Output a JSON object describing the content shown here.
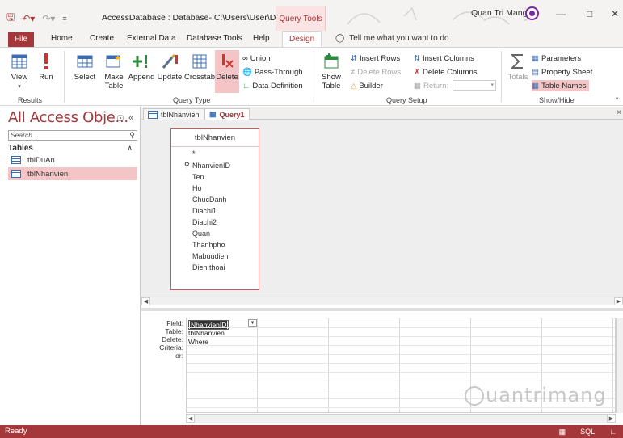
{
  "title_bar": {
    "doc_title": "AccessDatabase : Database- C:\\Users\\User\\Docu...",
    "context_tab": "Query Tools",
    "user": "Quan Tri Mang",
    "save_icon": "save-icon",
    "undo_icon": "undo-icon",
    "redo_icon": "redo-icon"
  },
  "ribbon_tabs": {
    "file": "File",
    "home": "Home",
    "create": "Create",
    "external": "External Data",
    "dbtools": "Database Tools",
    "help": "Help",
    "design": "Design",
    "tell_me": "Tell me what you want to do"
  },
  "ribbon": {
    "results": {
      "view": "View",
      "run": "Run",
      "label": "Results"
    },
    "query_type": {
      "select": "Select",
      "make_table": "Make\nTable",
      "make_table_1": "Make",
      "make_table_2": "Table",
      "append": "Append",
      "update": "Update",
      "crosstab": "Crosstab",
      "delete": "Delete",
      "union": "Union",
      "pass_through": "Pass-Through",
      "data_definition": "Data Definition",
      "label": "Query Type"
    },
    "query_setup": {
      "show_table_1": "Show",
      "show_table_2": "Table",
      "insert_rows": "Insert Rows",
      "delete_rows": "Delete Rows",
      "builder": "Builder",
      "insert_columns": "Insert Columns",
      "delete_columns": "Delete Columns",
      "return": "Return:",
      "label": "Query Setup"
    },
    "show_hide": {
      "totals": "Totals",
      "parameters": "Parameters",
      "property_sheet": "Property Sheet",
      "table_names": "Table Names",
      "label": "Show/Hide"
    }
  },
  "nav_pane": {
    "title": "All Access Obje...",
    "search_placeholder": "Search...",
    "group": "Tables",
    "items": [
      "tblDuAn",
      "tblNhanvien"
    ],
    "selected": "tblNhanvien"
  },
  "doc_tabs": [
    "tblNhanvien",
    "Query1"
  ],
  "active_tab": "Query1",
  "design_table": {
    "name": "tblNhanvien",
    "fields": [
      "*",
      "NhanvienID",
      "Ten",
      "Ho",
      "ChucDanh",
      "Diachi1",
      "Diachi2",
      "Quan",
      "Thanhpho",
      "Mabuudien",
      "Dien thoai"
    ]
  },
  "query_grid": {
    "row_labels": [
      "Field:",
      "Table:",
      "Delete:",
      "Criteria:",
      "or:"
    ],
    "column1": {
      "field": "NhanvienID",
      "table": "tblNhanvien",
      "delete": "Where"
    }
  },
  "watermark": "uantrimang",
  "status_bar": {
    "text": "Ready"
  },
  "colors": {
    "accent": "#a4373a",
    "highlight": "#f4c5c7"
  }
}
